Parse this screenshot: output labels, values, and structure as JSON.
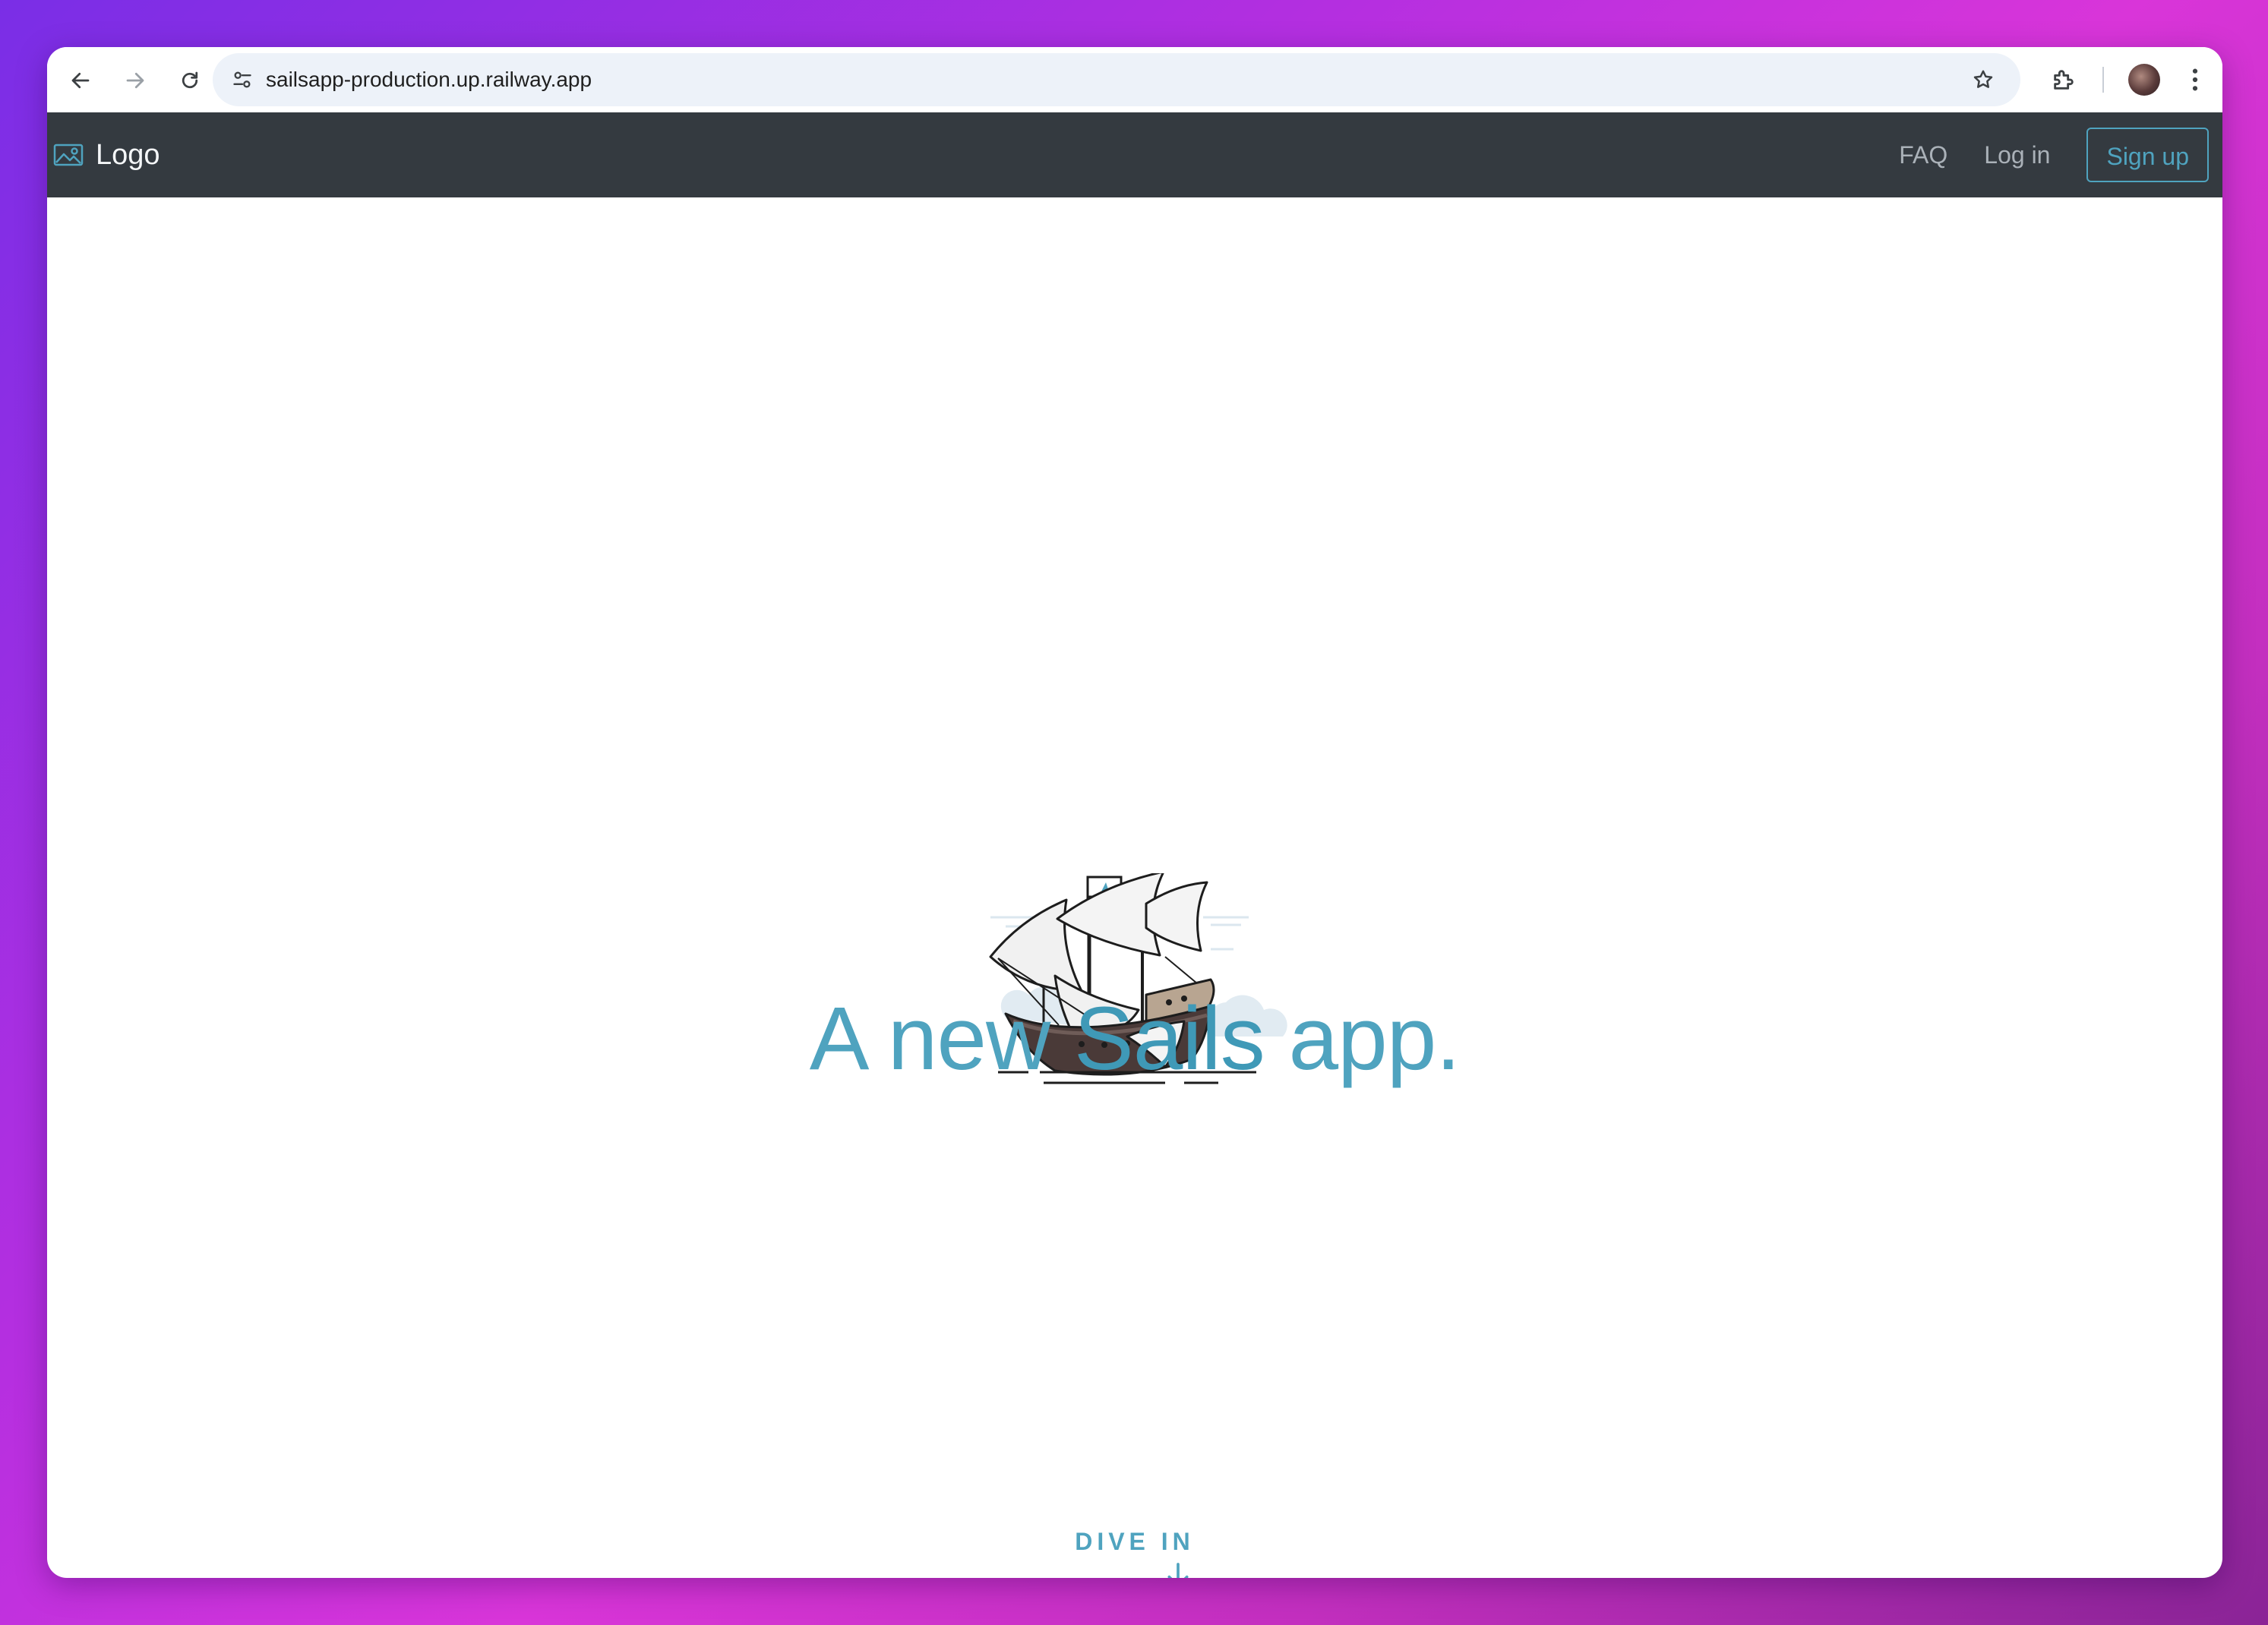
{
  "browser": {
    "url": "sailsapp-production.up.railway.app",
    "back_icon": "arrow-left-icon",
    "forward_icon": "arrow-right-icon",
    "reload_icon": "reload-icon",
    "site_info_icon": "tune-icon",
    "bookmark_icon": "star-icon",
    "extensions_icon": "puzzle-icon",
    "menu_icon": "kebab-icon"
  },
  "navbar": {
    "brand_icon": "image-icon",
    "brand_text": "Logo",
    "links": [
      "FAQ",
      "Log in"
    ],
    "signup_label": "Sign up",
    "background": "#343a40",
    "accent": "#4fa3bf"
  },
  "hero": {
    "illustration": "ship-icon",
    "headline_part1": "A new ",
    "headline_part2": "Sails",
    "headline_part3": " app.",
    "dive_label": "DIVE IN",
    "dive_icon": "arrow-down-icon"
  }
}
